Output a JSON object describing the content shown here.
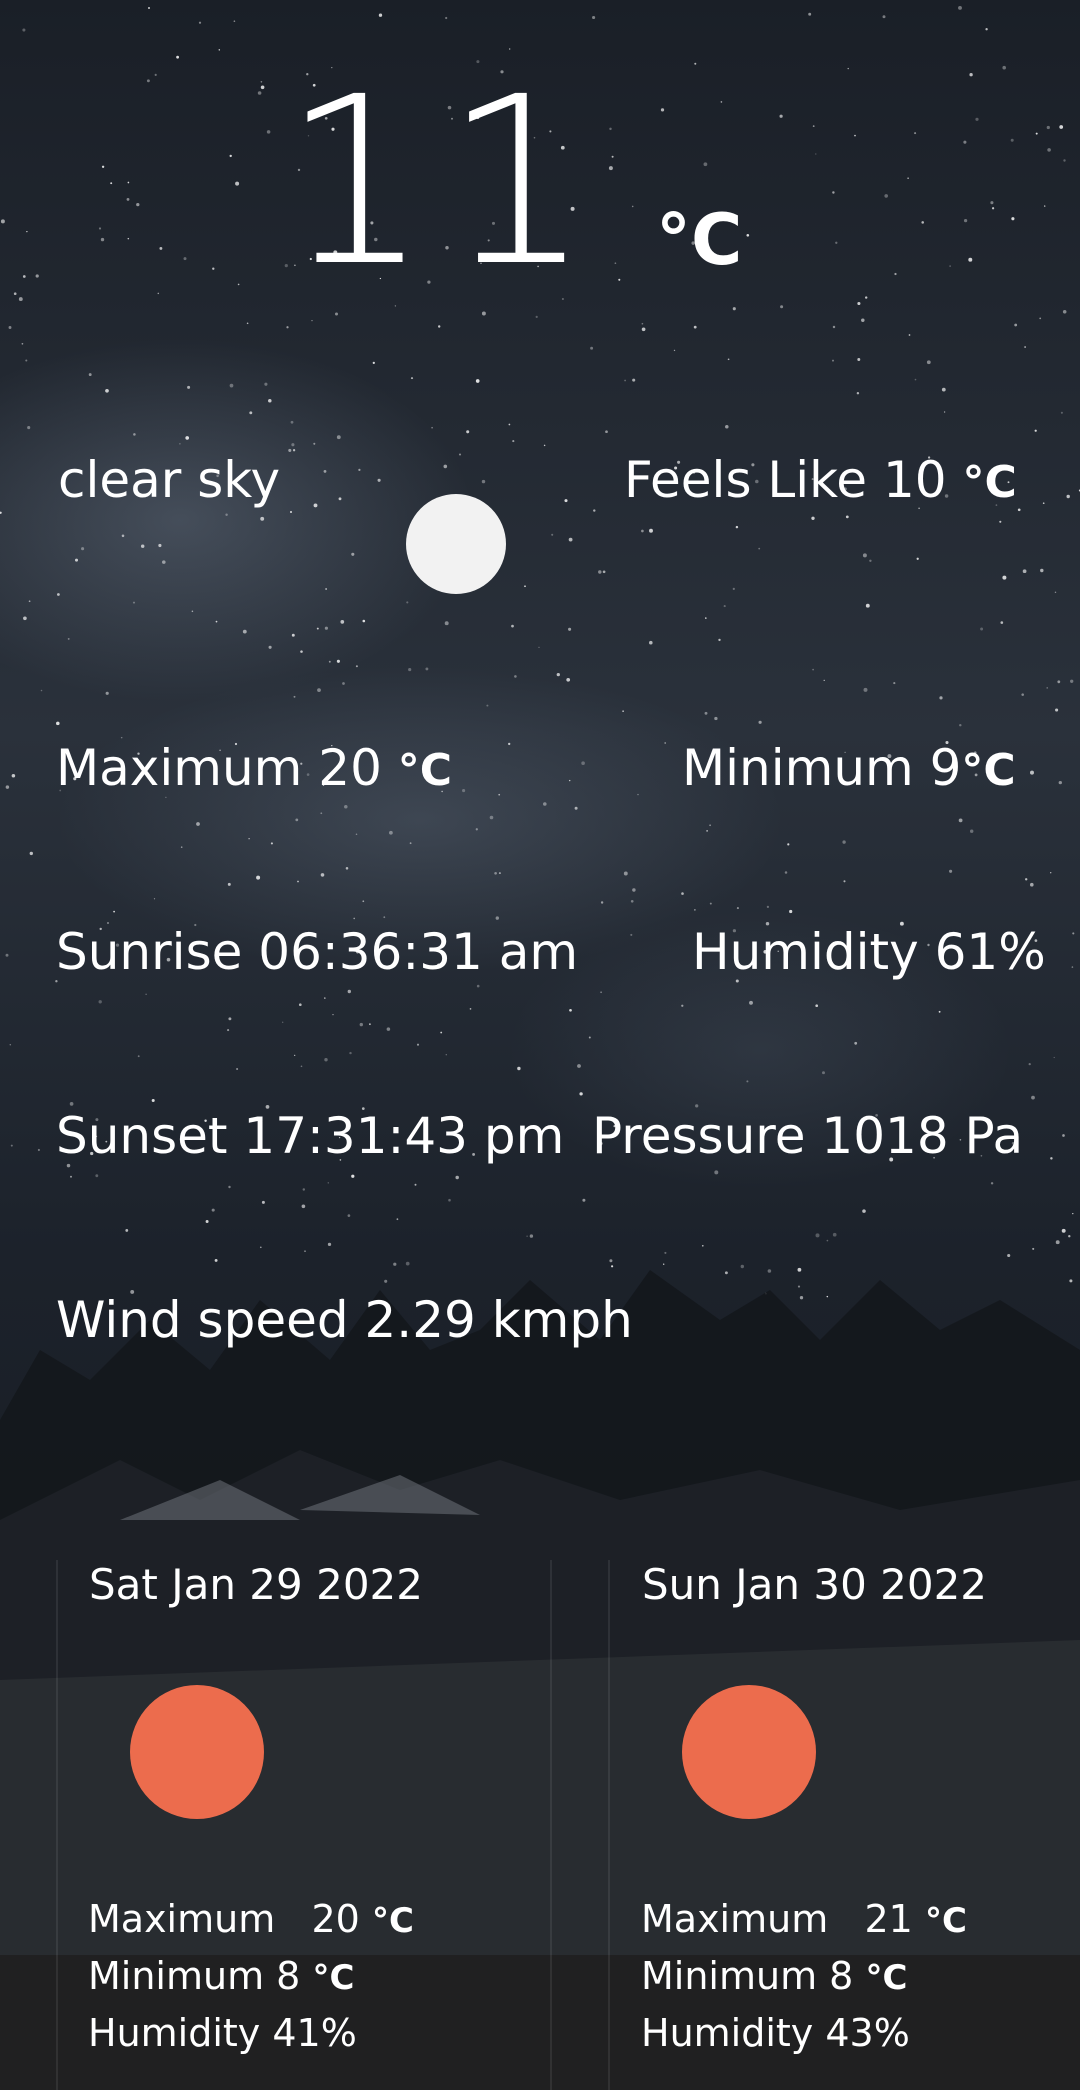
{
  "current": {
    "temperature": "11",
    "unit": "°C",
    "description": "clear sky",
    "icon": "moon-icon",
    "feels_like": "Feels Like 10",
    "maximum": "Maximum 20",
    "minimum": "Minimum 9",
    "sunrise": "Sunrise 06:36:31 am",
    "humidity": "Humidity 61%",
    "sunset": "Sunset 17:31:43 pm",
    "pressure": "Pressure 1018 Pa",
    "wind": "Wind speed 2.29  kmph"
  },
  "forecast": [
    {
      "date": "Sat Jan 29 2022",
      "icon": "sun-icon",
      "max_label": "Maximum",
      "max_value": "20",
      "min": "Minimum 8",
      "humidity": "Humidity 41%"
    },
    {
      "date": "Sun Jan 30 2022",
      "icon": "sun-icon",
      "max_label": "Maximum",
      "max_value": "21",
      "min": "Minimum 8",
      "humidity": "Humidity 43%"
    }
  ],
  "colors": {
    "sun": "#ec6c4d",
    "moon": "#f2f2f2",
    "text": "#ffffff"
  }
}
